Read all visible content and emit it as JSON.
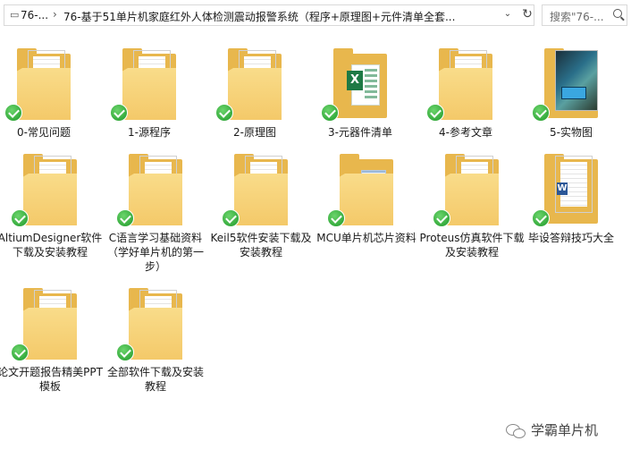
{
  "address_bar": {
    "crumbs": [
      "76-...",
      "76-基于51单片机家庭红外人体检测震动报警系统（程序+原理图+元件清单全套..."
    ],
    "separator": "›",
    "dropdown_glyph": "⌄",
    "refresh_glyph": "↻"
  },
  "search": {
    "placeholder": "搜索\"76-..."
  },
  "items": [
    {
      "label": "0-常见问题",
      "kind": "folder-doc"
    },
    {
      "label": "1-源程序",
      "kind": "folder-doc"
    },
    {
      "label": "2-原理图",
      "kind": "folder-doc"
    },
    {
      "label": "3-元器件清单",
      "kind": "folder-excel"
    },
    {
      "label": "4-参考文章",
      "kind": "folder-doc"
    },
    {
      "label": "5-实物图",
      "kind": "folder-photo"
    },
    {
      "label": "AltiumDesigner软件下载及安装教程",
      "kind": "folder-doc"
    },
    {
      "label": "C语言学习基础资料（学好单片机的第一步）",
      "kind": "folder-doc"
    },
    {
      "label": "Keil5软件安装下载及安装教程",
      "kind": "folder-doc"
    },
    {
      "label": "MCU单片机芯片资料",
      "kind": "folder-blue"
    },
    {
      "label": "Proteus仿真软件下载及安装教程",
      "kind": "folder-doc"
    },
    {
      "label": "毕设答辩技巧大全",
      "kind": "folder-word"
    },
    {
      "label": "论文开题报告精美PPT模板",
      "kind": "folder-doc"
    },
    {
      "label": "全部软件下载及安装教程",
      "kind": "folder-doc"
    }
  ],
  "watermark": {
    "text": "学霸单片机"
  }
}
